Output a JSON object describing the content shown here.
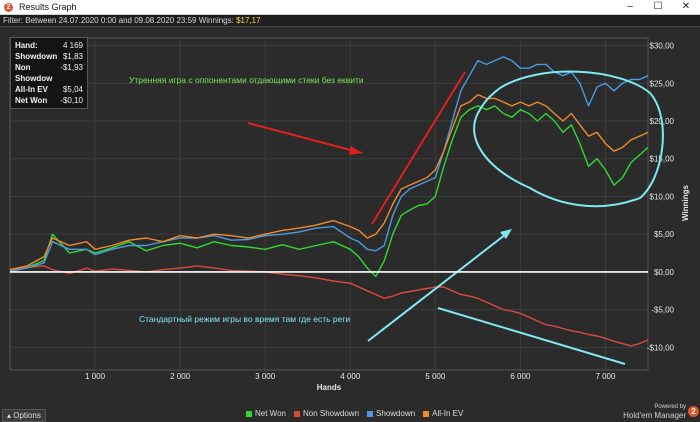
{
  "window": {
    "title": "Results Graph",
    "app_icon_letter": "2",
    "minimize_glyph": "–",
    "maximize_glyph": "☐",
    "close_glyph": "✕"
  },
  "filter": {
    "prefix": "Filter: ",
    "range": "Between 24.07.2020 0:00 and 09.08.2020 23:59",
    "winnings_label": " Winnings: ",
    "winnings_value": "$17,17"
  },
  "stats": [
    {
      "label": "Hand:",
      "value": "4 169"
    },
    {
      "label": "Showdown",
      "value": "$1,83"
    },
    {
      "label": "Non Showdow",
      "value": "-$1,93"
    },
    {
      "label": "All-In EV",
      "value": "$5,04"
    },
    {
      "label": "Net Won",
      "value": "-$0,10"
    }
  ],
  "annotations": {
    "green": "Утренняя игра с оппонентами отдающими стеки без еквити",
    "cyan": "Стандартный режим игры во время там где есть реги"
  },
  "bottom": {
    "options_label": "Options",
    "options_arrow": "▴",
    "powered_by": "Powered by",
    "brand": "Hold'em Manager",
    "brand_logo": "2"
  },
  "colors": {
    "background": "#2b2b2b",
    "grid": "#3c3c3c",
    "net_won": "#2fd82f",
    "non_showdown": "#d84a40",
    "showdown": "#4a9ae0",
    "all_in_ev": "#f08a2a",
    "annotation_green": "#7fe35a",
    "annotation_cyan": "#7fe8f0",
    "annotation_red": "#e02020"
  },
  "chart_data": {
    "type": "line",
    "title": "",
    "xlabel": "Hands",
    "ylabel": "Winnings",
    "xlim": [
      0,
      7500
    ],
    "ylim": [
      -13,
      31
    ],
    "x_ticks": [
      1000,
      2000,
      3000,
      4000,
      5000,
      6000,
      7000
    ],
    "x_tick_labels": [
      "1 000",
      "2 000",
      "3 000",
      "4 000",
      "5 000",
      "6 000",
      "7 000"
    ],
    "y_ticks": [
      30,
      25,
      20,
      15,
      10,
      5,
      0,
      -5,
      -10
    ],
    "y_tick_labels": [
      "$30,00",
      "$25,00",
      "$20,00",
      "$15,00",
      "$10,00",
      "$5,00",
      "$0,00",
      "-$5,00",
      "-$10,00"
    ],
    "grid": true,
    "legend_position": "bottom",
    "x": [
      0,
      200,
      400,
      500,
      700,
      900,
      1000,
      1200,
      1400,
      1600,
      1800,
      2000,
      2200,
      2400,
      2600,
      2800,
      3000,
      3200,
      3400,
      3600,
      3800,
      4000,
      4100,
      4200,
      4300,
      4400,
      4500,
      4600,
      4700,
      4800,
      4900,
      5000,
      5100,
      5200,
      5300,
      5400,
      5500,
      5600,
      5700,
      5800,
      5900,
      6000,
      6100,
      6200,
      6300,
      6400,
      6500,
      6600,
      6700,
      6800,
      6900,
      7000,
      7100,
      7200,
      7300,
      7400,
      7500
    ],
    "series": [
      {
        "name": "Net Won",
        "color": "#2fd82f",
        "values": [
          0.2,
          0.6,
          1.5,
          5.0,
          2.5,
          3.0,
          2.5,
          3.2,
          4.0,
          2.8,
          3.5,
          3.8,
          3.2,
          4.0,
          3.5,
          3.3,
          3.0,
          3.6,
          3.0,
          3.5,
          4.0,
          3.0,
          2.0,
          0.5,
          -0.6,
          1.5,
          5.0,
          7.5,
          8.2,
          8.8,
          9.0,
          10.0,
          14.0,
          17.5,
          20.5,
          21.5,
          22.0,
          21.5,
          22.0,
          21.0,
          20.5,
          21.5,
          21.0,
          20.0,
          21.0,
          20.0,
          18.5,
          19.5,
          17.0,
          14.0,
          15.0,
          13.5,
          11.5,
          12.5,
          14.5,
          15.5,
          16.5
        ]
      },
      {
        "name": "Non Showdown",
        "color": "#d84a40",
        "values": [
          0.2,
          0.6,
          0.8,
          0.3,
          -0.2,
          0.5,
          0.1,
          0.4,
          0.2,
          0.0,
          0.3,
          0.5,
          0.8,
          0.5,
          0.2,
          0.1,
          0.0,
          -0.3,
          -0.5,
          -0.8,
          -1.2,
          -1.5,
          -2.0,
          -2.5,
          -3.0,
          -3.5,
          -3.2,
          -2.8,
          -2.6,
          -2.4,
          -2.2,
          -2.0,
          -2.0,
          -2.5,
          -3.0,
          -3.2,
          -3.5,
          -4.0,
          -4.5,
          -5.0,
          -5.2,
          -5.5,
          -6.0,
          -6.5,
          -7.0,
          -7.2,
          -7.5,
          -7.8,
          -8.0,
          -8.3,
          -8.5,
          -8.8,
          -9.2,
          -9.5,
          -9.8,
          -9.5,
          -9.0
        ]
      },
      {
        "name": "Showdown",
        "color": "#4a9ae0",
        "values": [
          0.1,
          0.5,
          1.2,
          4.0,
          3.0,
          3.0,
          2.3,
          3.0,
          3.5,
          3.5,
          4.0,
          4.5,
          4.5,
          4.8,
          4.2,
          4.3,
          4.8,
          5.0,
          5.3,
          5.8,
          6.0,
          4.5,
          4.0,
          3.0,
          2.8,
          3.5,
          7.5,
          10.0,
          11.0,
          11.5,
          12.0,
          12.5,
          16.0,
          20.0,
          24.0,
          26.0,
          28.0,
          27.5,
          28.0,
          28.5,
          28.0,
          27.0,
          27.0,
          27.5,
          27.5,
          26.5,
          26.0,
          26.5,
          25.0,
          22.0,
          24.5,
          25.0,
          24.0,
          25.0,
          25.5,
          25.5,
          26.0
        ]
      },
      {
        "name": "All-In EV",
        "color": "#f08a2a",
        "values": [
          0.3,
          0.8,
          2.0,
          4.5,
          3.5,
          4.0,
          3.0,
          3.5,
          4.2,
          4.5,
          4.0,
          4.8,
          4.5,
          5.0,
          4.8,
          4.5,
          5.0,
          5.5,
          5.8,
          6.2,
          6.8,
          6.0,
          5.5,
          4.5,
          5.0,
          6.5,
          9.0,
          11.0,
          11.5,
          12.0,
          12.5,
          13.5,
          16.0,
          19.0,
          22.0,
          22.5,
          23.5,
          23.0,
          23.0,
          22.5,
          22.0,
          22.5,
          22.0,
          22.5,
          22.0,
          21.0,
          20.0,
          21.0,
          19.5,
          18.0,
          18.5,
          17.0,
          16.0,
          16.5,
          17.5,
          18.0,
          18.5
        ]
      }
    ]
  },
  "legend": [
    {
      "label": "Net Won",
      "color": "#2fd82f"
    },
    {
      "label": "Non Showdown",
      "color": "#d84a40"
    },
    {
      "label": "Showdown",
      "color": "#4a9ae0"
    },
    {
      "label": "All-In EV",
      "color": "#f08a2a"
    }
  ]
}
